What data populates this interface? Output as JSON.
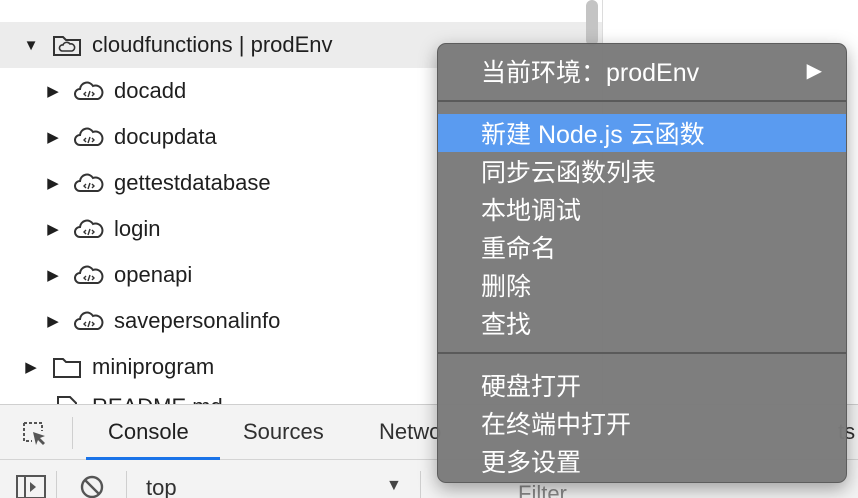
{
  "tree": {
    "items": [
      {
        "label": "cloudfunctions | prodEnv",
        "expanded": true,
        "icon": "cloud-folder-icon"
      },
      {
        "label": "docadd",
        "icon": "cloud-function-icon"
      },
      {
        "label": "docupdata",
        "icon": "cloud-function-icon"
      },
      {
        "label": "gettestdatabase",
        "icon": "cloud-function-icon"
      },
      {
        "label": "login",
        "icon": "cloud-function-icon"
      },
      {
        "label": "openapi",
        "icon": "cloud-function-icon"
      },
      {
        "label": "savepersonalinfo",
        "icon": "cloud-function-icon"
      },
      {
        "label": "miniprogram",
        "icon": "folder-icon"
      },
      {
        "label": "README.md",
        "icon": "file-icon"
      }
    ]
  },
  "context_menu": {
    "env_item": "当前环境：prodEnv",
    "groups": [
      [
        "新建 Node.js 云函数",
        "同步云函数列表",
        "本地调试",
        "重命名",
        "删除",
        "查找"
      ],
      [
        "硬盘打开",
        "在终端中打开",
        "更多设置"
      ]
    ],
    "highlighted": "新建 Node.js 云函数"
  },
  "devtools": {
    "tabs": [
      "Console",
      "Sources",
      "Netwo",
      "ts"
    ],
    "active_tab": "Console",
    "context": "top",
    "filter_placeholder": "Filter"
  },
  "colors": {
    "menu_highlight": "#5a9bf0",
    "menu_background": "#7a7a7a",
    "tab_underline": "#1a73e8"
  }
}
